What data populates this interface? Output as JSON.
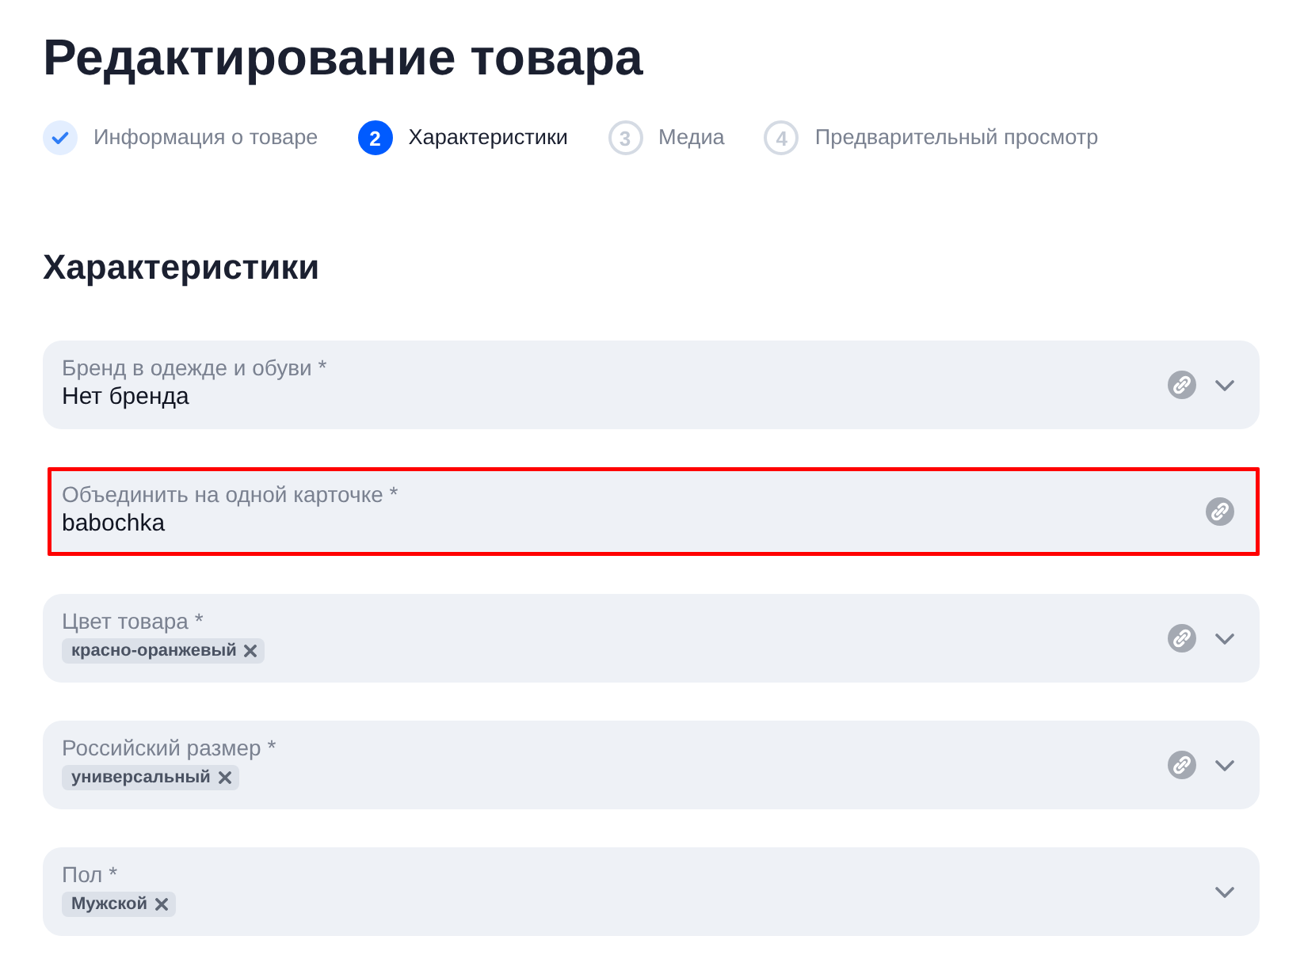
{
  "page": {
    "title": "Редактирование товара"
  },
  "steps": [
    {
      "label": "Информация о товаре",
      "done": true,
      "selected": false
    },
    {
      "number": "2",
      "label": "Характеристики",
      "done": false,
      "selected": true
    },
    {
      "number": "3",
      "label": "Медиа",
      "done": false,
      "selected": false
    },
    {
      "number": "4",
      "label": "Предварительный просмотр",
      "done": false,
      "selected": false
    }
  ],
  "section": {
    "title": "Характеристики"
  },
  "fields": [
    {
      "kind": "select",
      "label": "Бренд в одежде и обуви *",
      "value": "Нет бренда",
      "linked": true,
      "highlighted": false
    },
    {
      "kind": "text",
      "label": "Объединить на одной карточке *",
      "value": "babochka",
      "linked": true,
      "highlighted": true
    },
    {
      "kind": "select",
      "label": "Цвет товара *",
      "tags": [
        "красно-оранжевый"
      ],
      "linked": true,
      "highlighted": false
    },
    {
      "kind": "select",
      "label": "Российский размер *",
      "tags": [
        "универсальный"
      ],
      "linked": true,
      "highlighted": false
    },
    {
      "kind": "select",
      "label": "Пол *",
      "tags": [
        "Мужской"
      ],
      "linked": false,
      "highlighted": false
    }
  ]
}
